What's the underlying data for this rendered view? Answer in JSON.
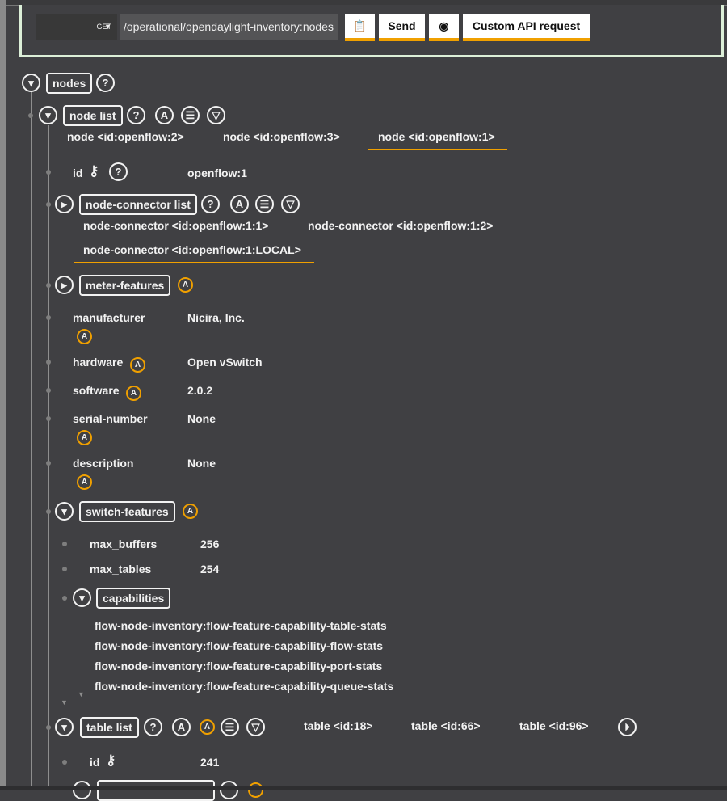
{
  "toolbar": {
    "method": "GET",
    "url": "/operational/opendaylight-inventory:nodes",
    "copy_icon": "copy-icon",
    "send_label": "Send",
    "preview_icon": "eye-icon",
    "custom_label": "Custom API request"
  },
  "tree": {
    "nodes_label": "nodes",
    "node_list_label": "node list",
    "node_tabs": [
      "node  <id:openflow:2>",
      "node  <id:openflow:3>",
      "node  <id:openflow:1>"
    ],
    "id_label": "id",
    "id_value": "openflow:1",
    "node_connector_label": "node-connector list",
    "nc_tabs": [
      "node-connector  <id:openflow:1:1>",
      "node-connector  <id:openflow:1:2>",
      "node-connector  <id:openflow:1:LOCAL>"
    ],
    "meter_features_label": "meter-features",
    "fields": [
      {
        "label": "manufacturer",
        "value": "Nicira, Inc."
      },
      {
        "label": "hardware",
        "value": "Open vSwitch"
      },
      {
        "label": "software",
        "value": "2.0.2"
      },
      {
        "label": "serial-number",
        "value": "None"
      },
      {
        "label": "description",
        "value": "None"
      }
    ],
    "switch_features_label": "switch-features",
    "max_buffers_label": "max_buffers",
    "max_buffers_value": "256",
    "max_tables_label": "max_tables",
    "max_tables_value": "254",
    "capabilities_label": "capabilities",
    "capabilities": [
      "flow-node-inventory:flow-feature-capability-table-stats",
      "flow-node-inventory:flow-feature-capability-flow-stats",
      "flow-node-inventory:flow-feature-capability-port-stats",
      "flow-node-inventory:flow-feature-capability-queue-stats"
    ],
    "table_list_label": "table list",
    "table_tabs": [
      "table  <id:18>",
      "table  <id:66>",
      "table  <id:96>"
    ],
    "table_id_label": "id",
    "table_id_value": "241",
    "help": "?",
    "aug": "A"
  },
  "colors": {
    "accent": "#f0a000",
    "background": "#404043",
    "panel_border": "#dcefd8"
  }
}
